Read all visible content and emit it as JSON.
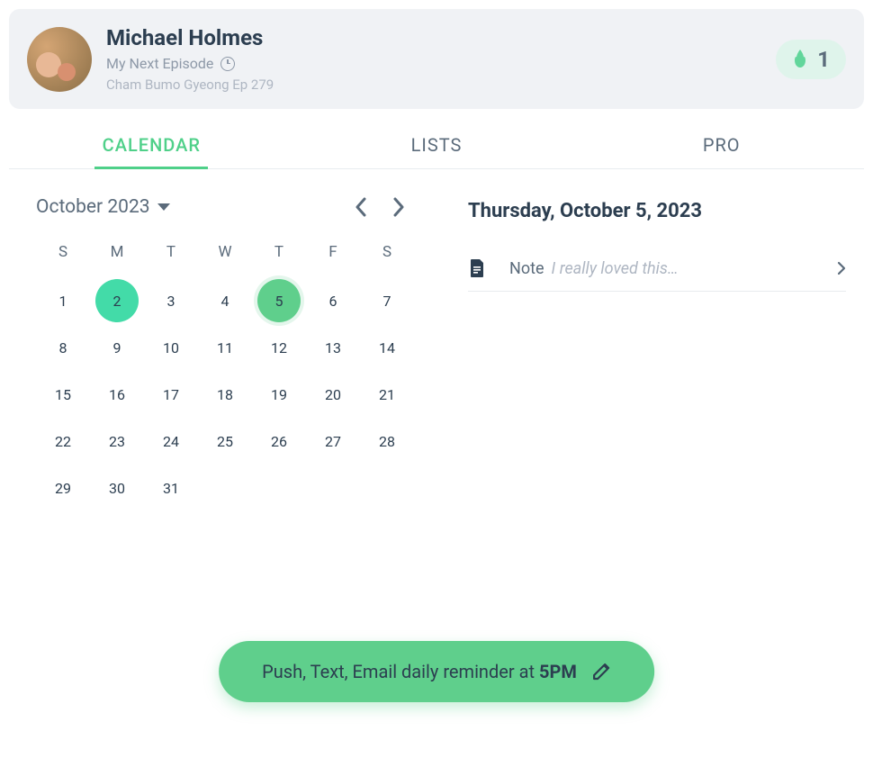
{
  "header": {
    "user_name": "Michael Holmes",
    "next_episode_label": "My Next Episode",
    "episode_text": "Cham Bumo Gyeong Ep 279",
    "streak_count": "1"
  },
  "tabs": {
    "calendar": "CALENDAR",
    "lists": "LISTS",
    "pro": "PRO"
  },
  "calendar": {
    "month_label": "October 2023",
    "weekdays": [
      "S",
      "M",
      "T",
      "W",
      "T",
      "F",
      "S"
    ],
    "weeks": [
      [
        "1",
        "2",
        "3",
        "4",
        "5",
        "6",
        "7"
      ],
      [
        "8",
        "9",
        "10",
        "11",
        "12",
        "13",
        "14"
      ],
      [
        "15",
        "16",
        "17",
        "18",
        "19",
        "20",
        "21"
      ],
      [
        "22",
        "23",
        "24",
        "25",
        "26",
        "27",
        "28"
      ],
      [
        "29",
        "30",
        "31",
        "",
        "",
        "",
        ""
      ]
    ],
    "highlight_teal": "2",
    "highlight_green": "5"
  },
  "detail": {
    "date_heading": "Thursday, October 5, 2023",
    "note_label": "Note",
    "note_preview": "I really loved this…"
  },
  "reminder": {
    "prefix": "Push, Text, Email daily reminder at ",
    "time": "5PM"
  }
}
